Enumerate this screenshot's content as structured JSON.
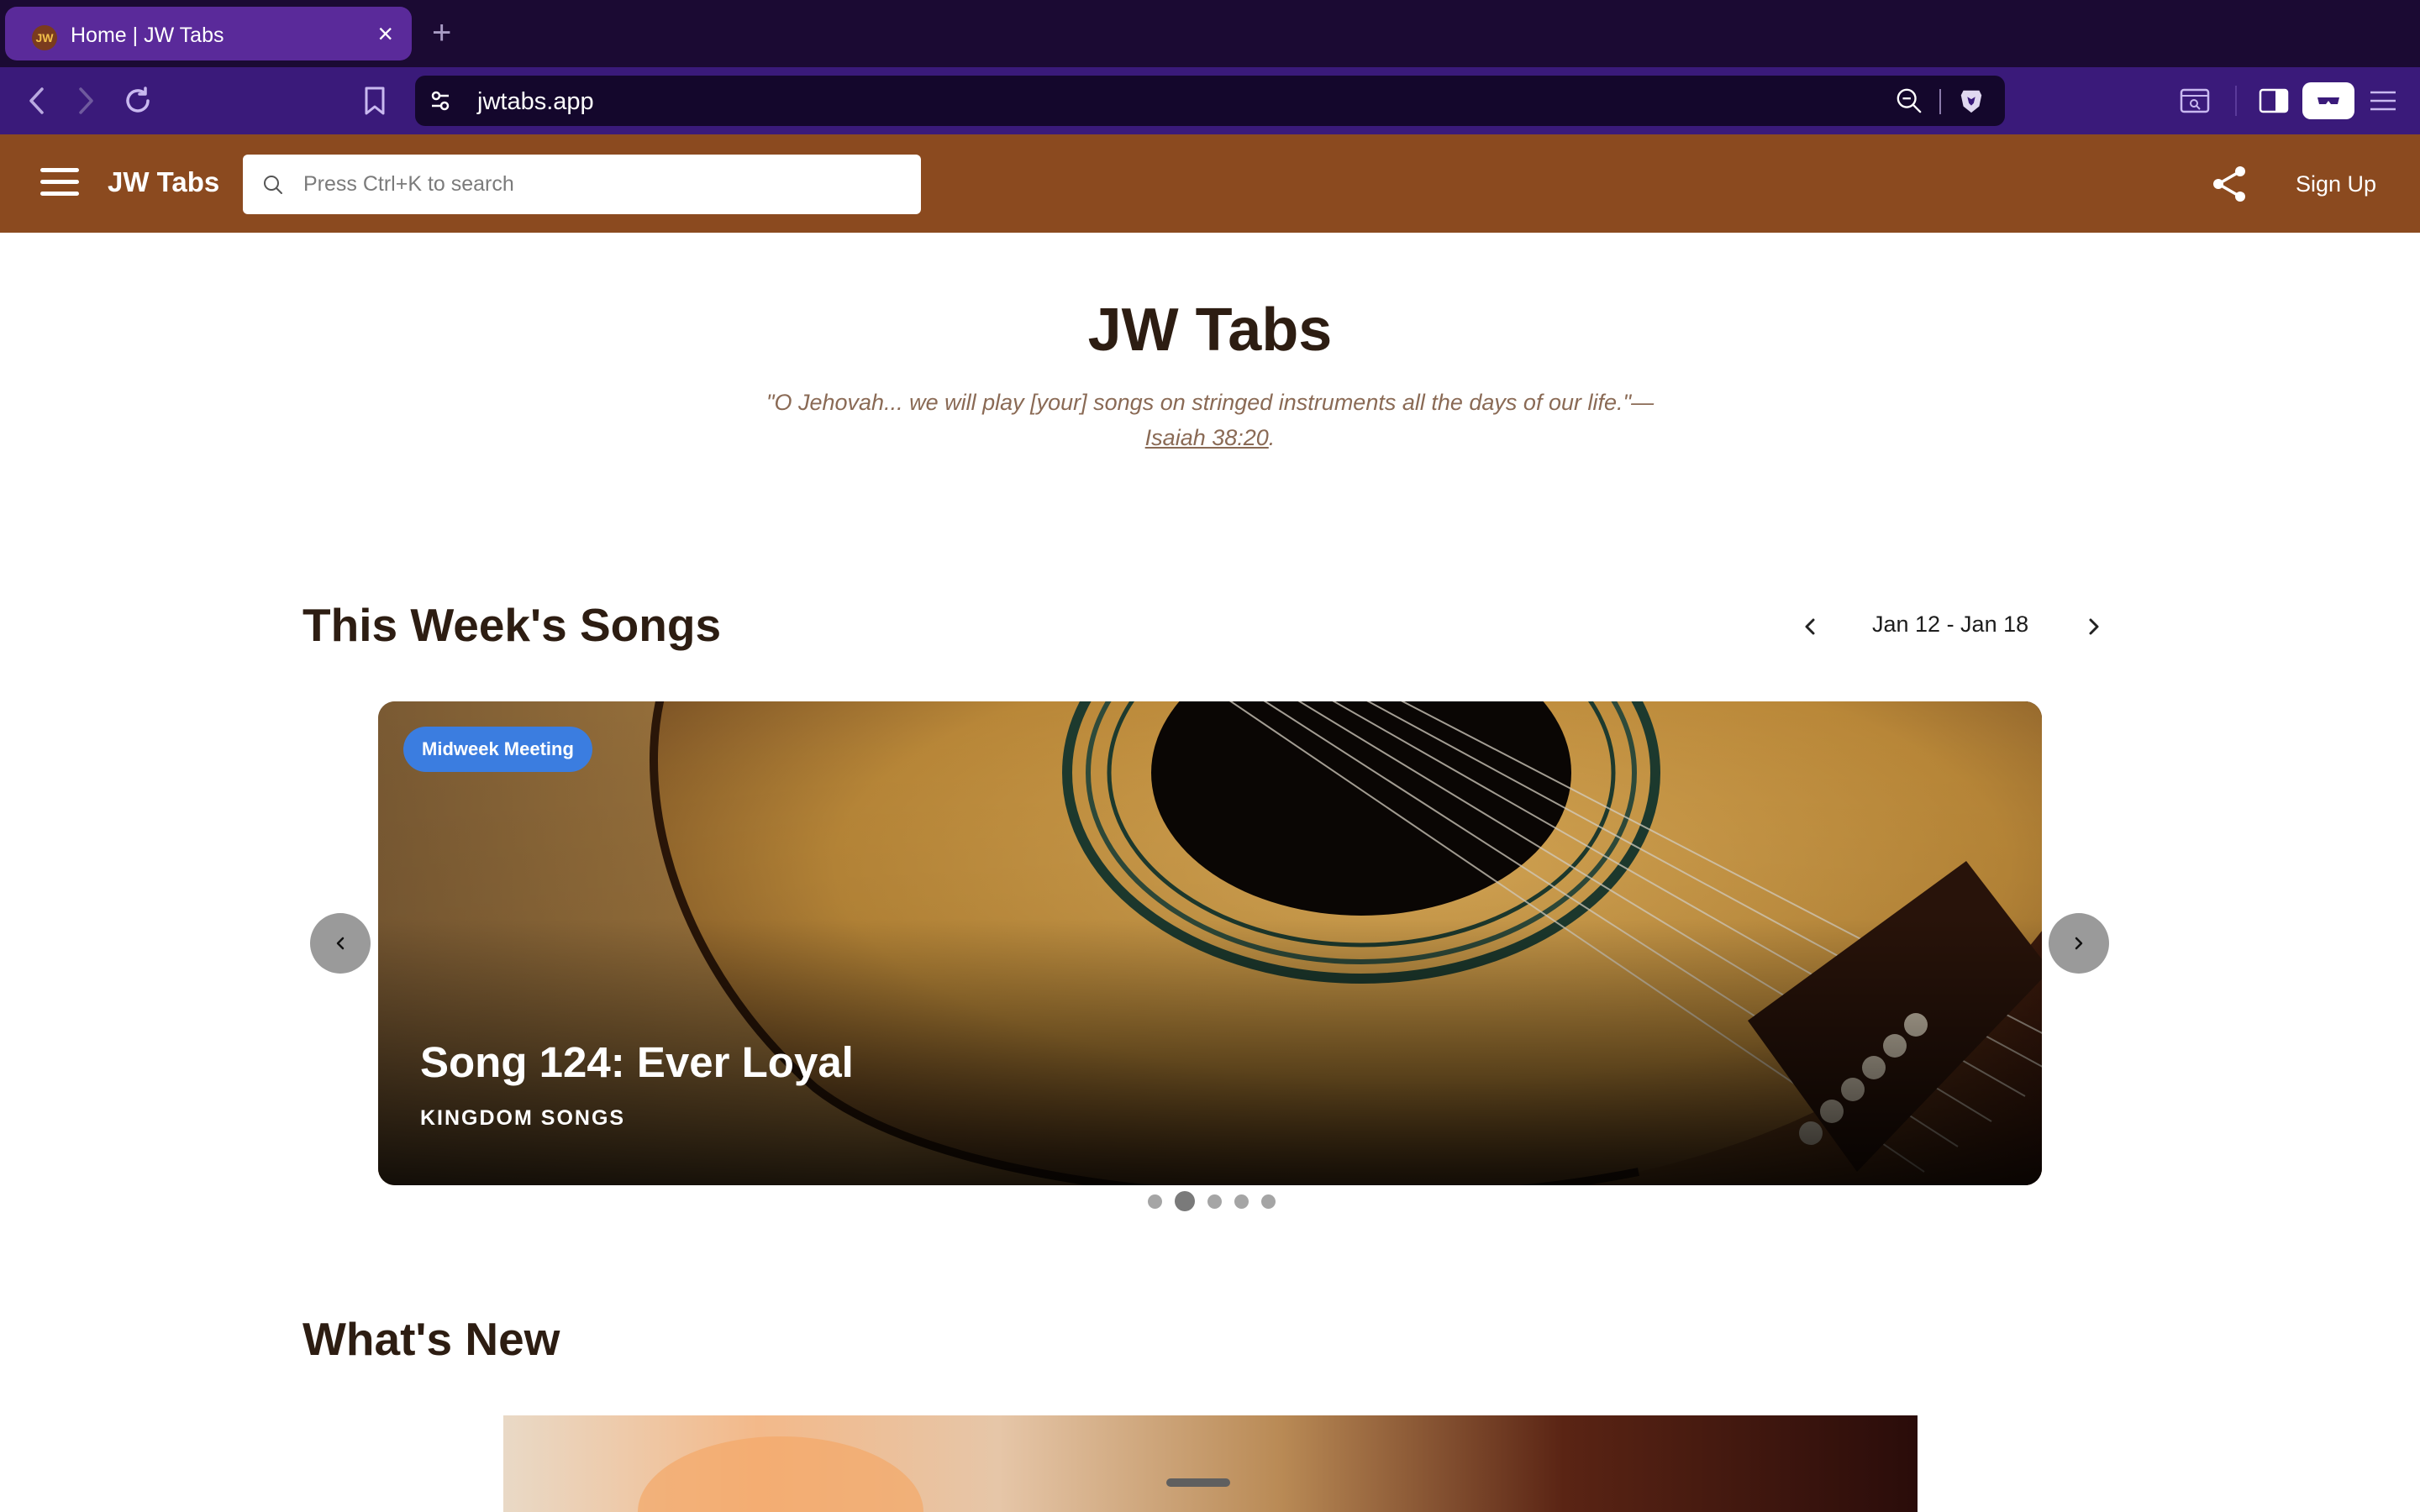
{
  "browser": {
    "tab_title": "Home | JW Tabs",
    "favicon_text": "JW",
    "url": "jwtabs.app"
  },
  "header": {
    "brand": "JW Tabs",
    "search_placeholder": "Press Ctrl+K to search",
    "signup_label": "Sign Up",
    "color": "#8b4a1f"
  },
  "hero": {
    "title": "JW Tabs",
    "quote": "\"O Jehovah... we will play [your] songs on stringed instruments all the days of our life.\"—",
    "citation": "Isaiah 38:20",
    "citation_end": "."
  },
  "week": {
    "title": "This Week's Songs",
    "range": "Jan 12 - Jan 18"
  },
  "carousel": {
    "badge": "Midweek Meeting",
    "song_title": "Song 124: Ever Loyal",
    "category": "KINGDOM SONGS",
    "slide_count": 5,
    "active_index": 1
  },
  "whats_new": {
    "title": "What's New"
  },
  "icons": [
    "back-icon",
    "forward-icon",
    "reload-icon",
    "bookmark-icon",
    "site-settings-icon",
    "zoom-out-icon",
    "brave-shield-icon",
    "screenshot-icon",
    "sidebar-icon",
    "leo-icon",
    "menu-icon",
    "search-icon",
    "share-icon",
    "hamburger-icon",
    "chevron-left-icon",
    "chevron-right-icon"
  ],
  "colors": {
    "badge": "#3b7de0",
    "heading": "#2d1d12",
    "tabstrip": "#1b0a33",
    "toolbar": "#3a1a7a"
  }
}
